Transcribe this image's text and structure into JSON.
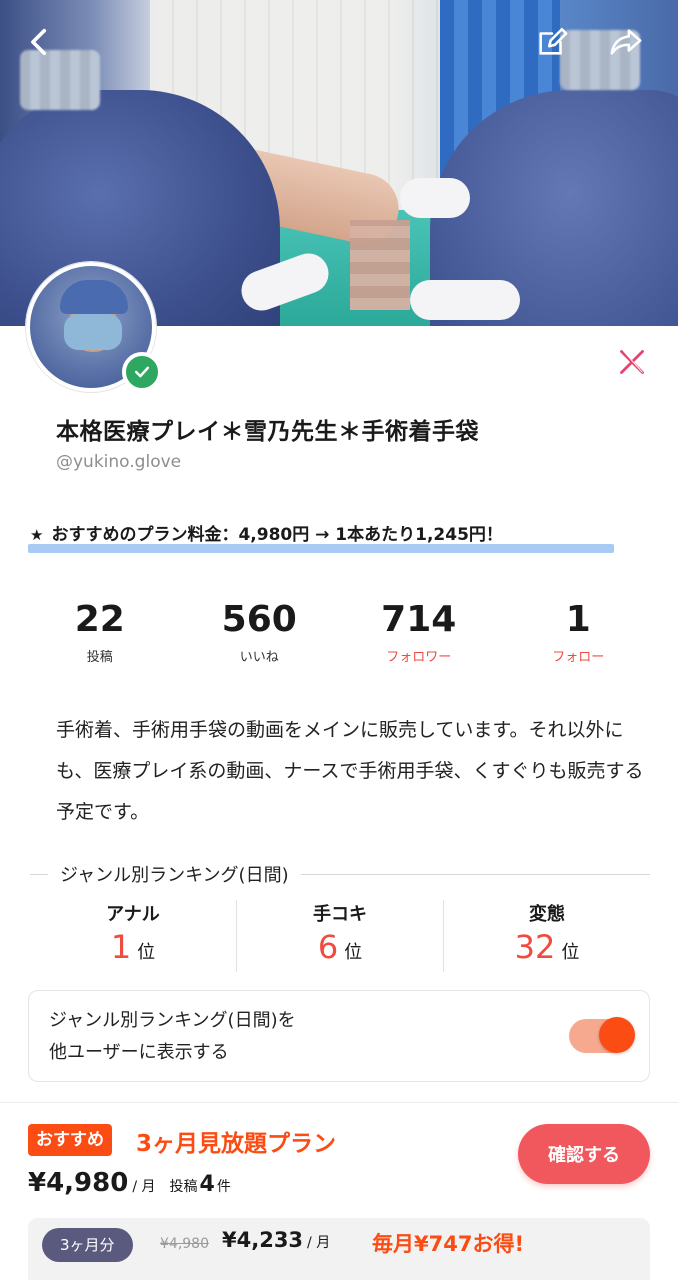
{
  "profile": {
    "name": "本格医療プレイ＊雪乃先生＊手術着手袋",
    "handle": "@yukino.glove",
    "verified_icon": "check-badge-icon",
    "social_icon": "x-logo-icon"
  },
  "promo": {
    "star": "★",
    "text": "おすすめのプラン料金：4,980円 → 1本あたり1,245円！"
  },
  "stats": [
    {
      "value": "22",
      "label": "投稿"
    },
    {
      "value": "560",
      "label": "いいね"
    },
    {
      "value": "714",
      "label": "フォロワー"
    },
    {
      "value": "1",
      "label": "フォロー"
    }
  ],
  "bio": "手術着、手術用手袋の動画をメインに販売しています。それ以外にも、医療プレイ系の動画、ナースで手術用手袋、くすぐりも販売する予定です。",
  "ranking": {
    "title": "ジャンル別ランキング(日間)",
    "items": [
      {
        "genre": "アナル",
        "rank": "1",
        "unit": "位"
      },
      {
        "genre": "手コキ",
        "rank": "6",
        "unit": "位"
      },
      {
        "genre": "変態",
        "rank": "32",
        "unit": "位"
      }
    ],
    "toggle_line1": "ジャンル別ランキング(日間)を",
    "toggle_line2": "他ユーザーに表示する",
    "toggle_on": true
  },
  "plan": {
    "badge": "おすすめ",
    "name": "3ヶ月見放題プラン",
    "price": "¥4,980",
    "per": "/ 月",
    "posts_label": "投稿",
    "posts_count": "4",
    "posts_unit": "件",
    "confirm": "確認する"
  },
  "offer": {
    "duration": "3ヶ月分",
    "old_price": "¥4,980",
    "new_price": "¥4,233",
    "per": "/ 月",
    "savings": "毎月¥747お得!"
  },
  "colors": {
    "accent": "#fb4c14",
    "rank": "#ef4b3e",
    "confirm": "#f0585d",
    "verified": "#2ea860",
    "highlight": "#a9cbf3"
  }
}
